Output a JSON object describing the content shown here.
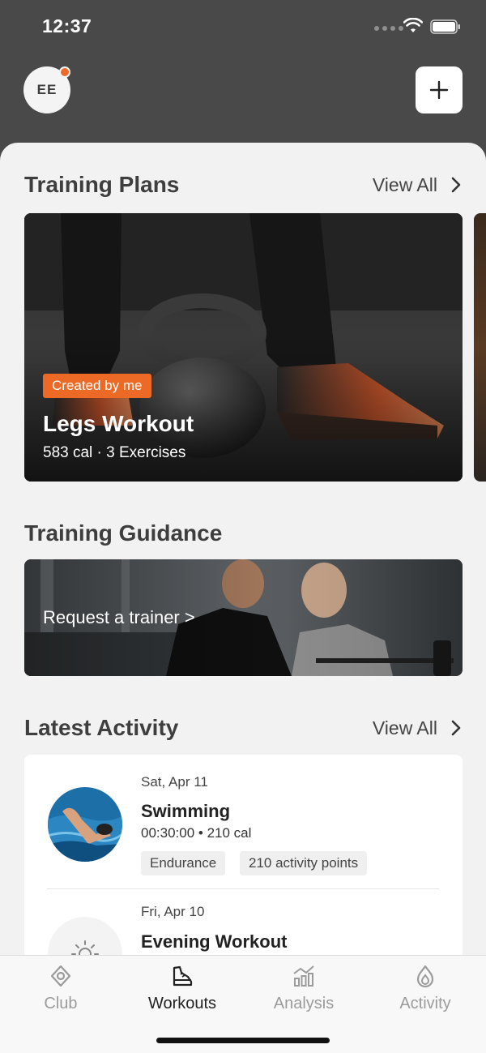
{
  "status_bar": {
    "time": "12:37"
  },
  "header": {
    "avatar_initials": "EE",
    "accent_color": "#ee6a28"
  },
  "training_plans": {
    "title": "Training Plans",
    "view_all": "View All",
    "card": {
      "tag": "Created by me",
      "title": "Legs Workout",
      "meta": "583 cal · 3 Exercises"
    }
  },
  "training_guidance": {
    "title": "Training Guidance",
    "cta": "Request a trainer >"
  },
  "latest_activity": {
    "title": "Latest Activity",
    "view_all": "View All",
    "items": [
      {
        "date": "Sat, Apr 11",
        "name": "Swimming",
        "meta": "00:30:00 • 210 cal",
        "chips": [
          "Endurance",
          "210 activity points"
        ]
      },
      {
        "date": "Fri, Apr 10",
        "name": "Evening Workout"
      }
    ]
  },
  "tabs": [
    {
      "label": "Club",
      "icon": "club-icon"
    },
    {
      "label": "Workouts",
      "icon": "workouts-icon",
      "active": true
    },
    {
      "label": "Analysis",
      "icon": "analysis-icon"
    },
    {
      "label": "Activity",
      "icon": "activity-icon"
    }
  ]
}
